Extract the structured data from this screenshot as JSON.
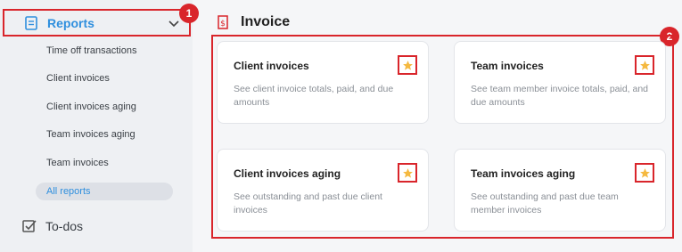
{
  "sidebar": {
    "reports_label": "Reports",
    "items": [
      {
        "label": "Time off transactions"
      },
      {
        "label": "Client invoices"
      },
      {
        "label": "Client invoices aging"
      },
      {
        "label": "Team invoices aging"
      },
      {
        "label": "Team invoices"
      },
      {
        "label": "All reports"
      }
    ],
    "todos_label": "To-dos"
  },
  "badges": {
    "one": "1",
    "two": "2"
  },
  "main": {
    "section_title": "Invoice",
    "cards": [
      {
        "title": "Client invoices",
        "description": "See client invoice totals, paid, and due amounts"
      },
      {
        "title": "Team invoices",
        "description": "See team member invoice totals, paid, and due amounts"
      },
      {
        "title": "Client invoices aging",
        "description": "See outstanding and past due client invoices"
      },
      {
        "title": "Team invoices aging",
        "description": "See outstanding and past due team member invoices"
      }
    ]
  },
  "colors": {
    "accent": "#2f8fde",
    "highlight": "#d9252b",
    "star": "#f5b940"
  },
  "icons": [
    "document-icon",
    "chevron-down-icon",
    "checkbox-icon",
    "invoice-icon",
    "star-icon"
  ]
}
